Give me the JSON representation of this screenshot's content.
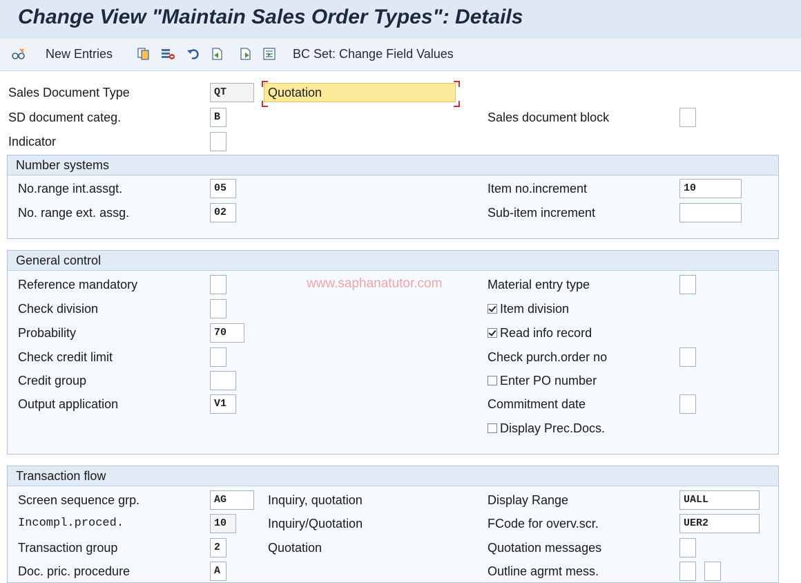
{
  "title": "Change View \"Maintain Sales Order Types\": Details",
  "toolbar": {
    "new_entries": "New Entries",
    "bc_set": "BC Set: Change Field Values",
    "icons": [
      "glasses-icon",
      "copy-icon",
      "delete-icon",
      "undo-icon",
      "previous-entry-icon",
      "next-entry-icon",
      "select-block-icon"
    ]
  },
  "header": {
    "sales_doc_type": {
      "label": "Sales Document Type",
      "code": "QT",
      "desc": "Quotation"
    },
    "sd_doc_categ": {
      "label": "SD document categ.",
      "value": "B"
    },
    "indicator": {
      "label": "Indicator",
      "value": ""
    },
    "sales_doc_block": {
      "label": "Sales document block",
      "value": ""
    }
  },
  "number_systems": {
    "title": "Number systems",
    "no_range_int": {
      "label": "No.range int.assgt.",
      "value": "05"
    },
    "no_range_ext": {
      "label": "No. range ext. assg.",
      "value": "02"
    },
    "item_no_incr": {
      "label": "Item no.increment",
      "value": "10"
    },
    "sub_item_incr": {
      "label": "Sub-item increment",
      "value": ""
    }
  },
  "general_control": {
    "title": "General control",
    "reference_mandatory": {
      "label": "Reference mandatory",
      "value": ""
    },
    "check_division": {
      "label": "Check division",
      "value": ""
    },
    "probability": {
      "label": "Probability",
      "value": "70"
    },
    "check_credit_limit": {
      "label": "Check credit limit",
      "value": ""
    },
    "credit_group": {
      "label": "Credit group",
      "value": ""
    },
    "output_application": {
      "label": "Output application",
      "value": "V1"
    },
    "material_entry_type": {
      "label": "Material entry type",
      "value": ""
    },
    "item_division": {
      "label": "Item division",
      "checked": true
    },
    "read_info_record": {
      "label": "Read info record",
      "checked": true
    },
    "check_purch_order": {
      "label": "Check purch.order no",
      "value": ""
    },
    "enter_po_number": {
      "label": "Enter PO number",
      "checked": false
    },
    "commitment_date": {
      "label": "Commitment  date",
      "value": ""
    },
    "display_prec_docs": {
      "label": "Display Prec.Docs.",
      "checked": false
    }
  },
  "transaction_flow": {
    "title": "Transaction flow",
    "screen_seq_grp": {
      "label": "Screen sequence grp.",
      "value": "AG",
      "desc": "Inquiry, quotation"
    },
    "incompl_proced": {
      "label": "Incompl.proced.",
      "value": "10",
      "desc": "Inquiry/Quotation"
    },
    "transaction_group": {
      "label": "Transaction group",
      "value": "2",
      "desc": "Quotation"
    },
    "doc_pric_procedure": {
      "label": "Doc. pric. procedure",
      "value": "A"
    },
    "display_range": {
      "label": "Display Range",
      "value": "UALL"
    },
    "fcode_overv": {
      "label": "FCode for overv.scr.",
      "value": "UER2"
    },
    "quotation_messages": {
      "label": "Quotation messages",
      "value": ""
    },
    "outline_agrmt_mess": {
      "label": "Outline agrmt mess.",
      "value": ""
    }
  },
  "watermark": "www.saphanatutor.com"
}
